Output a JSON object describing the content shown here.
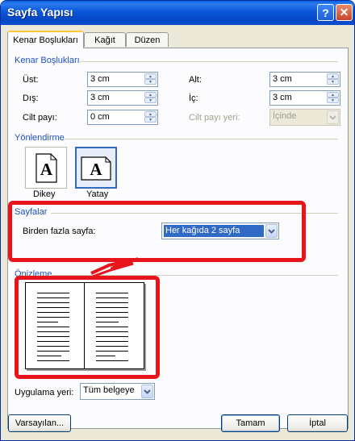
{
  "window": {
    "title": "Sayfa Yapısı",
    "help_btn": "?",
    "close_btn": "✕"
  },
  "tabs": [
    {
      "label": "Kenar Boşlukları",
      "active": true
    },
    {
      "label": "Kağıt",
      "active": false
    },
    {
      "label": "Düzen",
      "active": false
    }
  ],
  "margins": {
    "section": "Kenar Boşlukları",
    "top_label": "Üst:",
    "top_value": "3 cm",
    "bottom_label": "Alt:",
    "bottom_value": "3 cm",
    "outside_label": "Dış:",
    "outside_value": "3 cm",
    "inside_label": "İç:",
    "inside_value": "3 cm",
    "gutter_label": "Cilt payı:",
    "gutter_value": "0 cm",
    "gutter_pos_label": "Cilt payı yeri:",
    "gutter_pos_value": "İçinde"
  },
  "orientation": {
    "section": "Yönlendirme",
    "portrait_label": "Dikey",
    "landscape_label": "Yatay",
    "glyph": "A",
    "selected": "landscape"
  },
  "pages": {
    "section": "Sayfalar",
    "multiple_label": "Birden fazla sayfa:",
    "multiple_value": "Her kağıda 2 sayfa"
  },
  "preview": {
    "section": "Önizleme"
  },
  "apply": {
    "label": "Uygulama yeri:",
    "value": "Tüm belgeye"
  },
  "buttons": {
    "default_label": "Varsayılan...",
    "ok_label": "Tamam",
    "cancel_label": "İptal"
  },
  "colors": {
    "highlight": "#e8141c",
    "section_text": "#1e4fbd",
    "title_bar": "#0a55d8"
  }
}
